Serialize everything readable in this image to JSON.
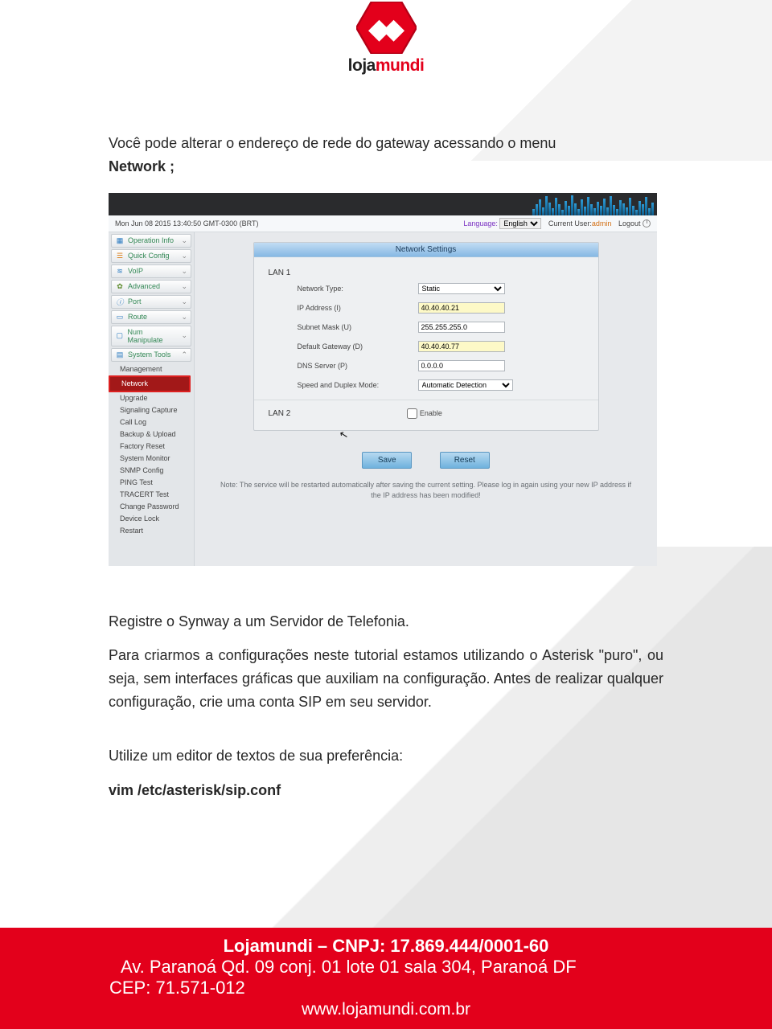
{
  "logo": {
    "brand1": "loja",
    "brand2": "mundi"
  },
  "copy": {
    "p1a": "Você pode alterar o endereço de rede do gateway acessando o menu ",
    "p1b": "Network ;"
  },
  "shot": {
    "datetime": "Mon Jun 08 2015 13:40:50 GMT-0300 (BRT)",
    "lang_label": "Language:",
    "lang_value": "English",
    "cur_user_label": "Current User:",
    "cur_user": "admin",
    "logout": "Logout",
    "sidebar": {
      "groups": [
        {
          "label": "Operation Info"
        },
        {
          "label": "Quick Config"
        },
        {
          "label": "VoIP"
        },
        {
          "label": "Advanced"
        },
        {
          "label": "Port"
        },
        {
          "label": "Route"
        },
        {
          "label": "Num Manipulate"
        },
        {
          "label": "System Tools"
        }
      ],
      "subs": [
        "Management",
        "Network",
        "Upgrade",
        "Signaling Capture",
        "Call Log",
        "Backup & Upload",
        "Factory Reset",
        "System Monitor",
        "SNMP Config",
        "PING Test",
        "TRACERT Test",
        "Change Password",
        "Device Lock",
        "Restart"
      ]
    },
    "panel": {
      "title": "Network Settings",
      "lan1": "LAN 1",
      "lan2": "LAN 2",
      "rows": {
        "net_type_l": "Network Type:",
        "net_type_v": "Static",
        "ip_l": "IP Address (I)",
        "ip_v": "40.40.40.21",
        "mask_l": "Subnet Mask (U)",
        "mask_v": "255.255.255.0",
        "gw_l": "Default Gateway (D)",
        "gw_v": "40.40.40.77",
        "dns_l": "DNS Server (P)",
        "dns_v": "0.0.0.0",
        "spd_l": "Speed and Duplex Mode:",
        "spd_v": "Automatic Detection"
      },
      "enable": "Enable",
      "save": "Save",
      "reset": "Reset",
      "note": "Note: The service will be restarted automatically after saving the current setting. Please log in again using your new IP address if the IP address has been modified!"
    }
  },
  "copy2": {
    "p1": "Registre o Synway a um Servidor de Telefonia.",
    "p2": "Para criarmos a configurações neste tutorial estamos utilizando o Asterisk \"puro\", ou seja, sem interfaces gráficas que auxiliam na configuração. Antes de realizar qualquer configuração, crie uma conta SIP em seu servidor.",
    "p3": "Utilize um editor de textos de sua preferência:",
    "p4": "vim /etc/asterisk/sip.conf"
  },
  "footer": {
    "l1": "Lojamundi – CNPJ: 17.869.444/0001-60",
    "l2": "Av. Paranoá Qd. 09 conj. 01 lote 01 sala 304, Paranoá DF",
    "l3": "CEP: 71.571-012",
    "l4": "www.lojamundi.com.br"
  }
}
